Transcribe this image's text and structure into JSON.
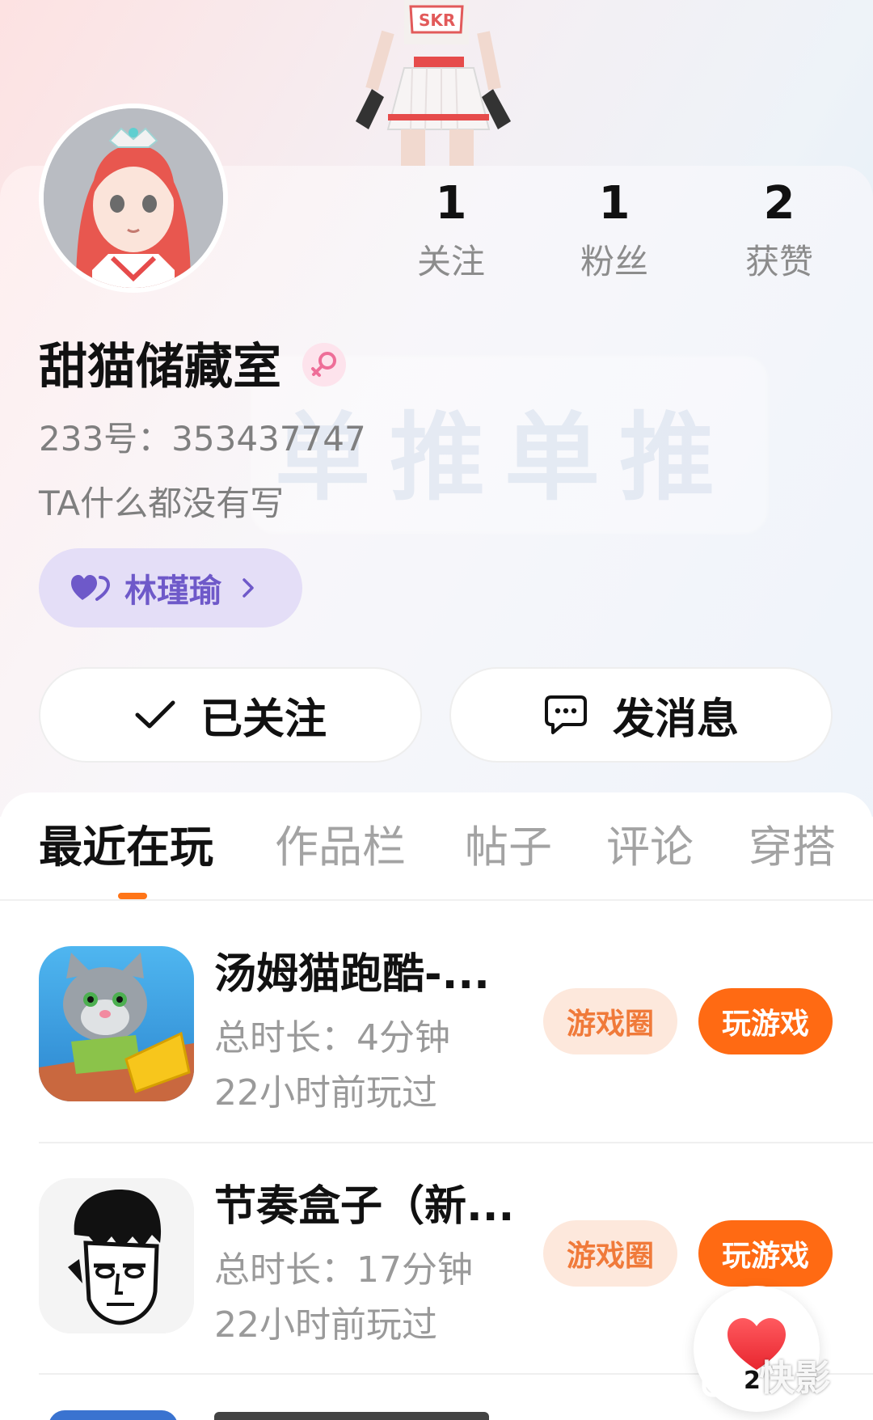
{
  "profile": {
    "username": "甜猫储藏室",
    "uid": "233号：353437747",
    "bio": "TA什么都没有写",
    "cp_name": "林瑾瑜",
    "watermark": "单推单推"
  },
  "stats": [
    {
      "value": "1",
      "label": "关注"
    },
    {
      "value": "1",
      "label": "粉丝"
    },
    {
      "value": "2",
      "label": "获赞"
    }
  ],
  "actions": {
    "follow_label": "已关注",
    "message_label": "发消息"
  },
  "tabs": [
    "最近在玩",
    "作品栏",
    "帖子",
    "评论",
    "穿搭"
  ],
  "games": [
    {
      "title": "汤姆猫跑酷-...",
      "duration": "总时长：4分钟",
      "last_played": "22小时前玩过",
      "circle_label": "游戏圈",
      "play_label": "玩游戏"
    },
    {
      "title": "节奏盒子（新...",
      "duration": "总时长：17分钟",
      "last_played": "22小时前玩过",
      "circle_label": "游戏圈",
      "play_label": "玩游戏"
    }
  ],
  "floating": {
    "like_count": "2",
    "brand": "快影"
  },
  "colors": {
    "accent": "#ff6a13",
    "cp_tag_bg": "#e4def7",
    "cp_tag_text": "#6e59c9"
  }
}
